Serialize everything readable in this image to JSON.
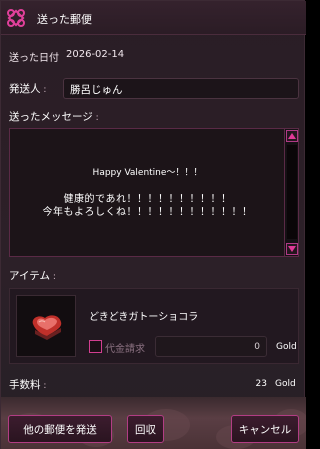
{
  "window": {
    "title": "送った郵便"
  },
  "sent_date": {
    "label": "送った日付",
    "value": "2026-02-14"
  },
  "sender": {
    "label": "発送人",
    "value": "勝呂じゅん"
  },
  "message": {
    "label": "送ったメッセージ",
    "lines": [
      "Happy Valentine～！！！",
      "健康的であれ！！！！！！！！！！",
      "今年もよろしくね！！！！！！！！！！！！"
    ]
  },
  "item": {
    "label": "アイテム",
    "name": "どきどきガトーショコラ",
    "cod_label": "代金請求",
    "cod_value": "0",
    "currency": "Gold"
  },
  "fee": {
    "label": "手数料",
    "value": "23",
    "currency": "Gold"
  },
  "buttons": {
    "send_other": "他の郵便を発送",
    "recall": "回収",
    "cancel": "キャンセル"
  },
  "colors": {
    "accent": "#d23e90",
    "window_bg": "#2a1d25",
    "field_bg": "#1c1418"
  }
}
